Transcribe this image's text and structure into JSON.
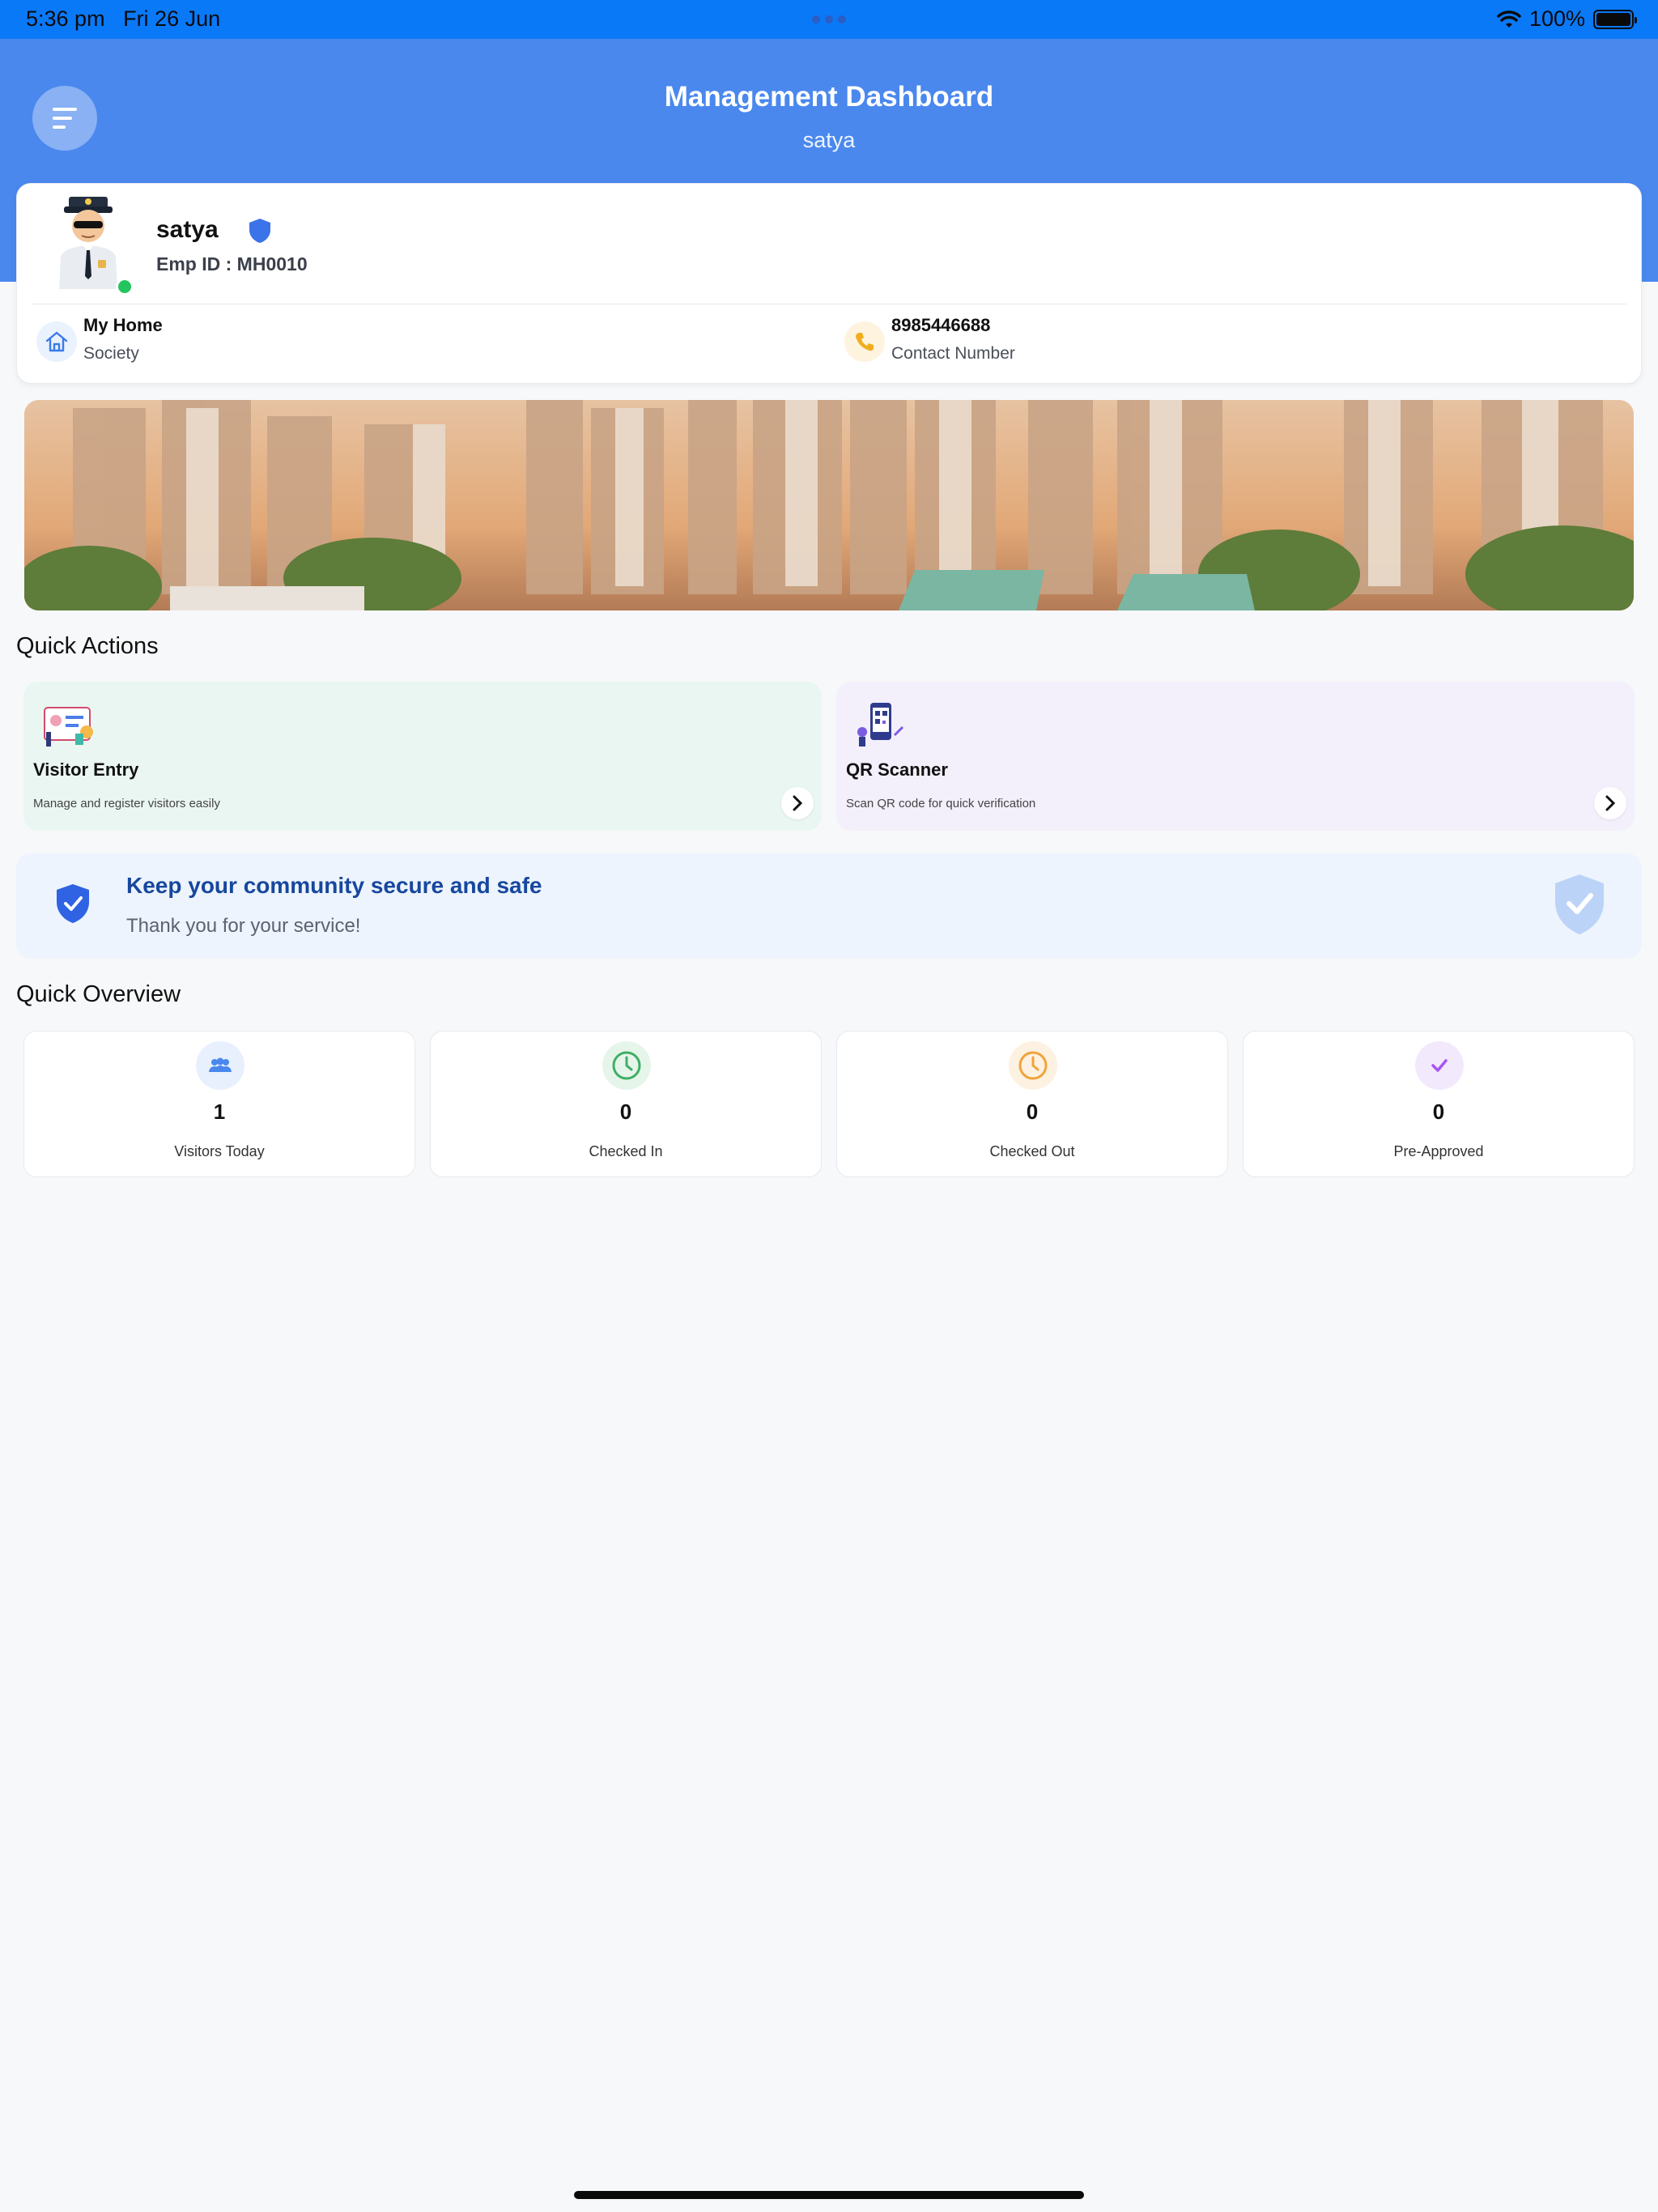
{
  "status_bar": {
    "time": "5:36 pm",
    "date": "Fri 26 Jun",
    "battery": "100%"
  },
  "header": {
    "title": "Management Dashboard",
    "subtitle": "satya",
    "menu_icon": "menu-icon"
  },
  "profile": {
    "name": "satya",
    "emp_id": "Emp ID : MH0010",
    "online": true,
    "society_name": "My Home",
    "society_label": "Society",
    "phone": "8985446688",
    "phone_label": "Contact Number"
  },
  "quick_actions": {
    "title": "Quick Actions",
    "items": [
      {
        "title": "Visitor Entry",
        "description": "Manage and register visitors easily",
        "color": "#eaf6f1"
      },
      {
        "title": "QR Scanner",
        "description": "Scan QR code for quick verification",
        "color": "#f3effb"
      }
    ]
  },
  "secure": {
    "title": "Keep your community secure and safe",
    "subtitle": "Thank you for your service!"
  },
  "overview": {
    "title": "Quick Overview",
    "items": [
      {
        "value": "1",
        "label": "Visitors Today",
        "icon": "users-icon",
        "color": "#4a88ee"
      },
      {
        "value": "0",
        "label": "Checked In",
        "icon": "clock-icon",
        "color": "#3fae64"
      },
      {
        "value": "0",
        "label": "Checked Out",
        "icon": "clock-icon",
        "color": "#f0a43a"
      },
      {
        "value": "0",
        "label": "Pre-Approved",
        "icon": "check-icon",
        "color": "#a855f7"
      }
    ]
  }
}
